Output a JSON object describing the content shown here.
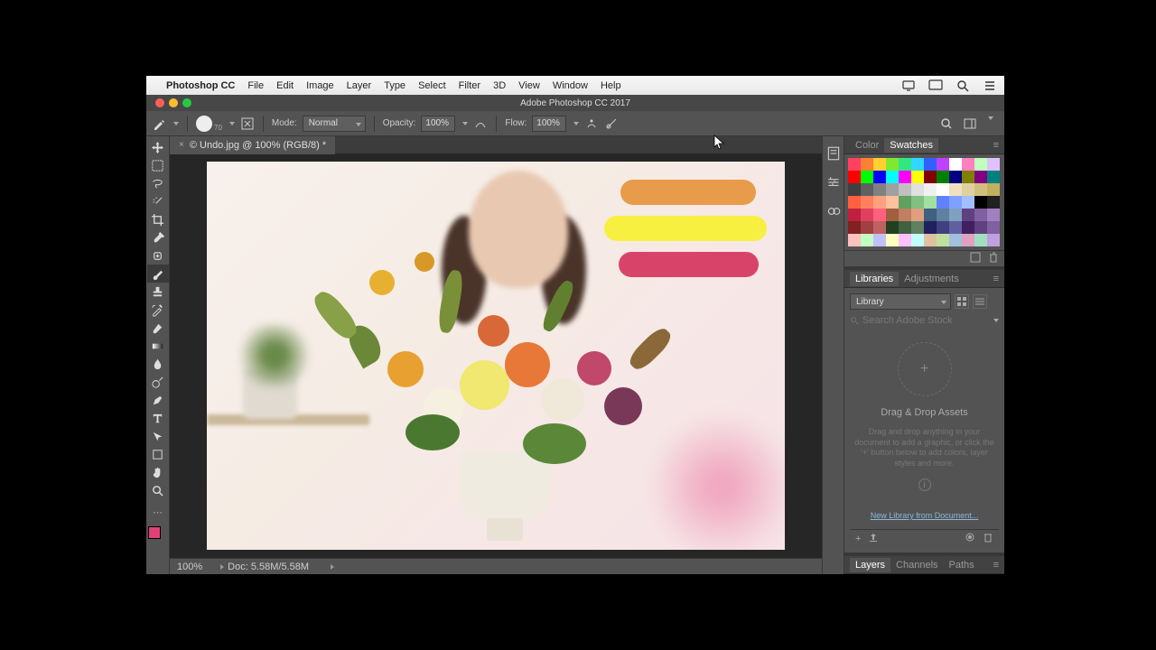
{
  "menubar": {
    "app": "Photoshop CC",
    "items": [
      "File",
      "Edit",
      "Image",
      "Layer",
      "Type",
      "Select",
      "Filter",
      "3D",
      "View",
      "Window",
      "Help"
    ]
  },
  "titlebar": {
    "title": "Adobe Photoshop CC 2017"
  },
  "optionbar": {
    "brush_size": "70",
    "mode_label": "Mode:",
    "mode_value": "Normal",
    "opacity_label": "Opacity:",
    "opacity_value": "100%",
    "flow_label": "Flow:",
    "flow_value": "100%"
  },
  "tab": {
    "name": "© Undo.jpg @ 100% (RGB/8) *"
  },
  "statusbar": {
    "zoom": "100%",
    "doc": "Doc: 5.58M/5.58M"
  },
  "panels": {
    "color": {
      "tabs": [
        "Color",
        "Swatches"
      ],
      "active": "Swatches"
    },
    "libraries": {
      "tabs": [
        "Libraries",
        "Adjustments"
      ],
      "active": "Libraries",
      "select": "Library",
      "search_placeholder": "Search Adobe Stock",
      "drop_title": "Drag & Drop Assets",
      "drop_desc": "Drag and drop anything in your document to add a graphic, or click the '+' button below to add colors, layer styles and more.",
      "link": "New Library from Document..."
    },
    "layers": {
      "tabs": [
        "Layers",
        "Channels",
        "Paths"
      ]
    }
  },
  "swatches": [
    [
      "#ff4060",
      "#ff8030",
      "#ffd030",
      "#80e830",
      "#30e880",
      "#30d8ff",
      "#3060ff",
      "#c040ff",
      "#ffffff",
      "#ff80c0",
      "#c0ffc0",
      "#e0c0ff"
    ],
    [
      "#ff0000",
      "#00ff00",
      "#0000ff",
      "#00ffff",
      "#ff00ff",
      "#ffff00",
      "#800000",
      "#008000",
      "#000080",
      "#808000",
      "#800080",
      "#008080"
    ],
    [
      "#404040",
      "#606060",
      "#808080",
      "#a0a0a0",
      "#c0c0c0",
      "#e0e0e0",
      "#f0f0f0",
      "#ffffff",
      "#f0e0c0",
      "#e0d0a0",
      "#d0c080",
      "#c0b060"
    ],
    [
      "#ff6040",
      "#ff8060",
      "#ffa080",
      "#ffc0a0",
      "#60a060",
      "#80c080",
      "#a0e0a0",
      "#6080ff",
      "#80a0ff",
      "#a0c0ff",
      "#000000",
      "#202020"
    ],
    [
      "#c02040",
      "#e04060",
      "#ff6080",
      "#a06040",
      "#c08060",
      "#e0a080",
      "#406080",
      "#6080a0",
      "#80a0c0",
      "#604080",
      "#8060a0",
      "#a080c0"
    ],
    [
      "#802020",
      "#a04040",
      "#c06060",
      "#204020",
      "#406040",
      "#608060",
      "#202060",
      "#404080",
      "#6060a0",
      "#402060",
      "#604080",
      "#8060a0"
    ],
    [
      "#ffc0c0",
      "#c0ffc0",
      "#c0c0ff",
      "#ffffc0",
      "#ffc0ff",
      "#c0ffff",
      "#e0c0a0",
      "#c0e0a0",
      "#a0c0e0",
      "#e0a0c0",
      "#a0e0c0",
      "#c0a0e0"
    ]
  ],
  "fg_color": "#e04078",
  "canvas": {
    "strokes": [
      {
        "color": "#e89b4a"
      },
      {
        "color": "#f8f040"
      },
      {
        "color": "#d8436a"
      }
    ]
  }
}
